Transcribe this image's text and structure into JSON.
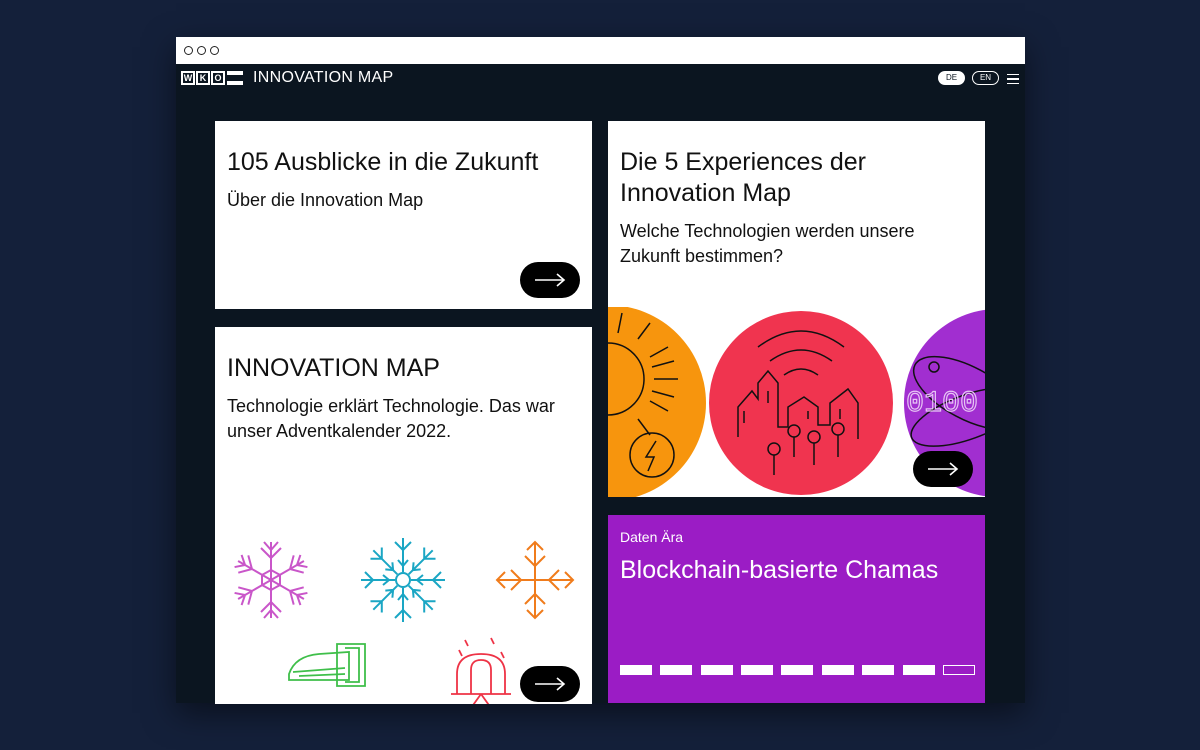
{
  "header": {
    "logo_letters": [
      "W",
      "K",
      "O"
    ],
    "brand": "INNOVATION MAP",
    "lang_de": "DE",
    "lang_en": "EN"
  },
  "cards": {
    "about": {
      "title": "105 Ausblicke in die Zukunft",
      "text": "Über die Innovation Map"
    },
    "advent": {
      "title": "INNOVATION MAP",
      "text": "Technologie erklärt Technologie. Das war unser Adventkalender 2022."
    },
    "experiences": {
      "title": "Die 5 Experiences der Innovation Map",
      "text": "Welche Technologien werden unsere Zukunft bestimmen?",
      "binary_label": "0100"
    },
    "feature": {
      "kicker": "Daten Ära",
      "title": "Blockchain-basierte Chamas",
      "slides_total": 9,
      "slide_active": 9
    }
  },
  "colors": {
    "page_bg": "#14203a",
    "app_bg": "#0b1520",
    "purple": "#9b1cc5",
    "orange": "#f7950d",
    "red": "#f0344f",
    "violet": "#a12ed0"
  },
  "icons": [
    "menu-icon",
    "arrow-right-icon",
    "snowflake-icon",
    "train-icon",
    "observatory-icon",
    "sun-icon",
    "city-icon"
  ]
}
